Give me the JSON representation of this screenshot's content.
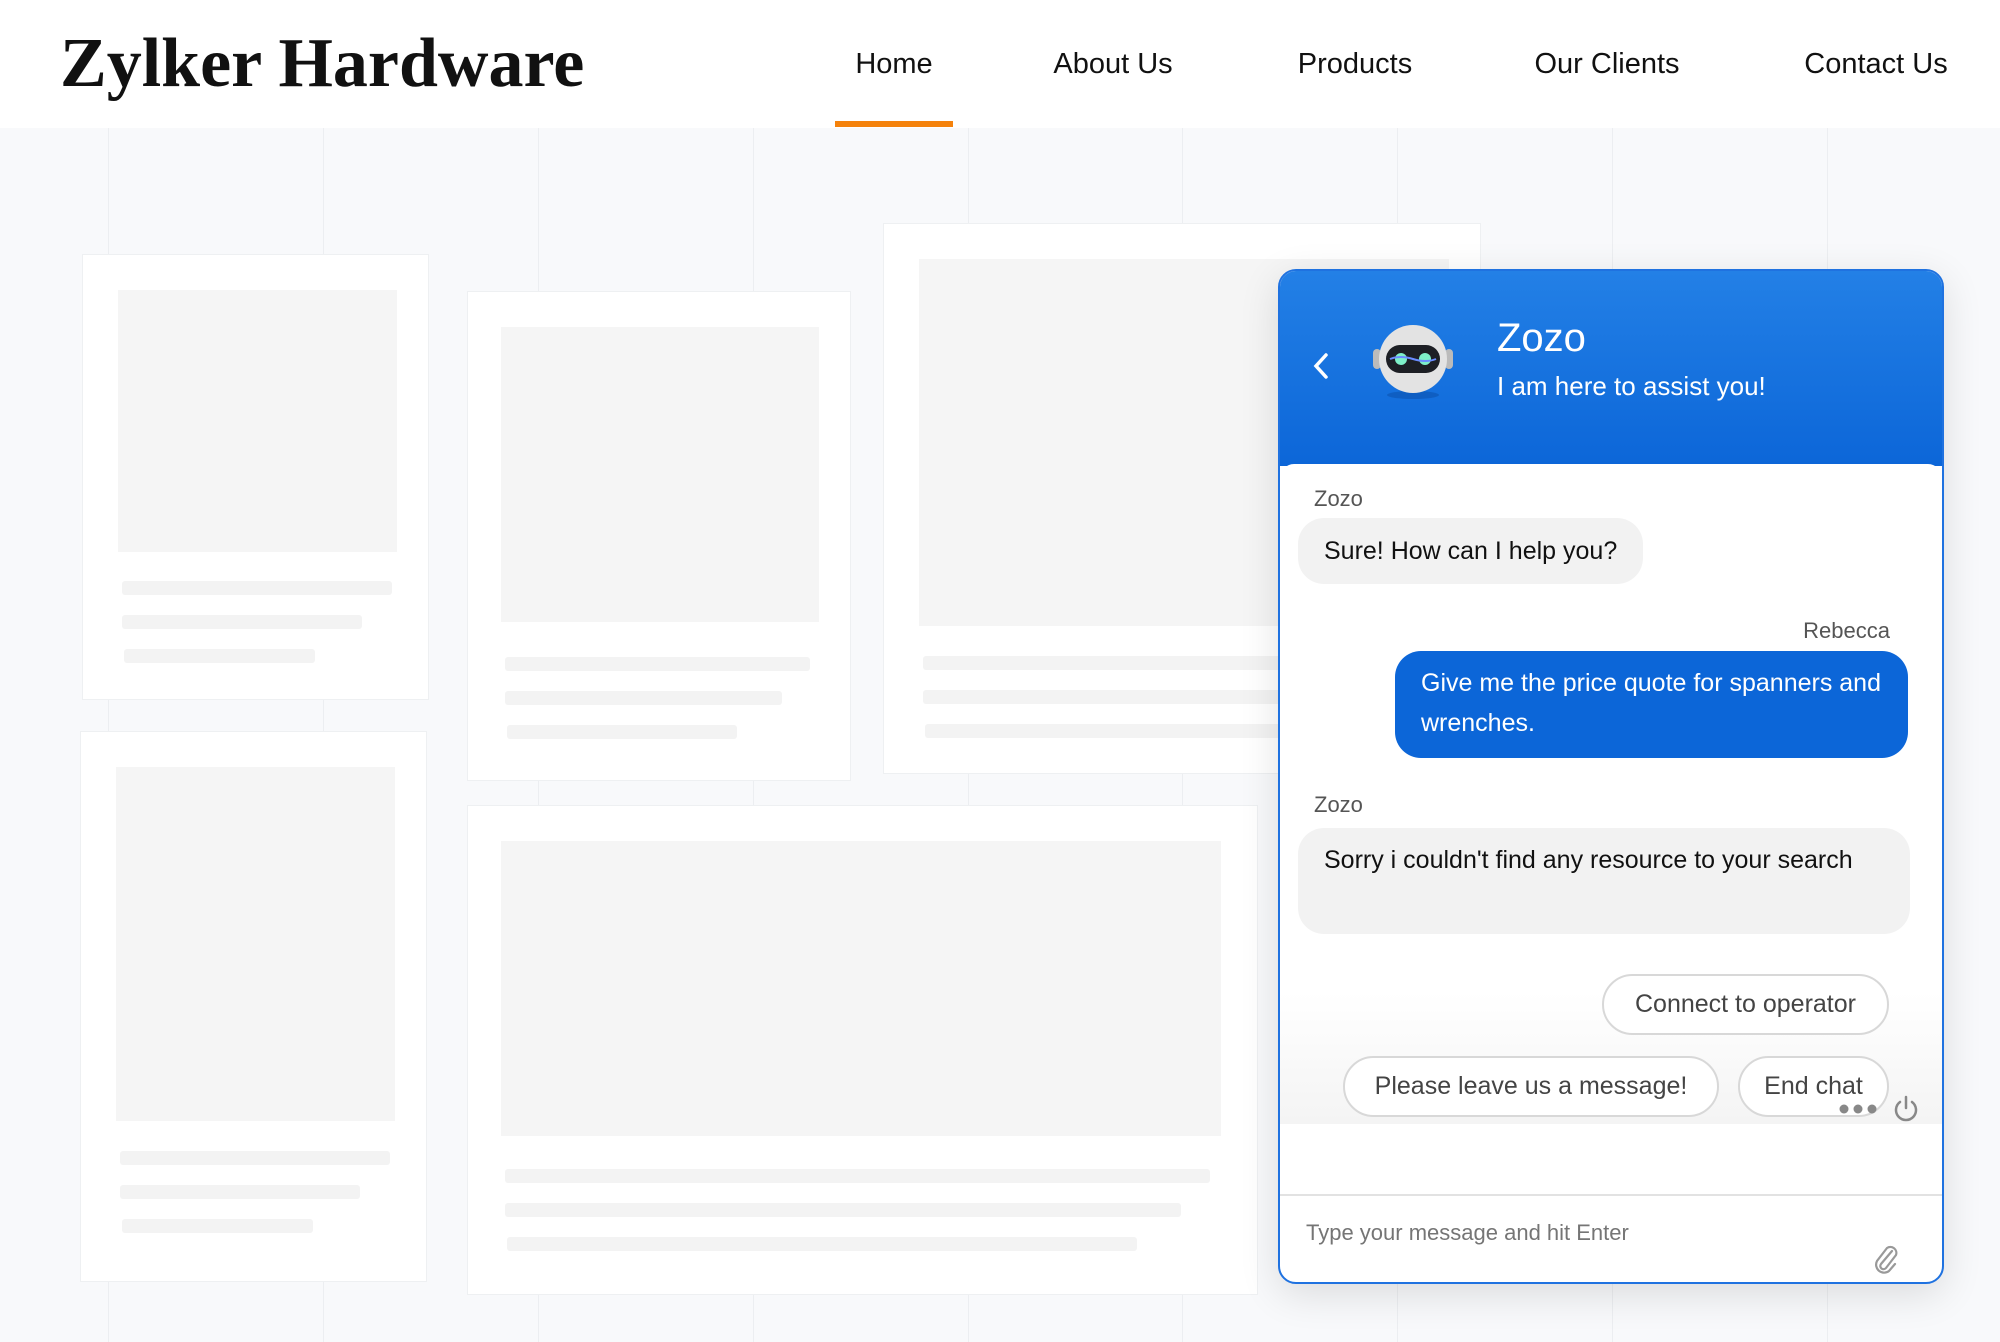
{
  "site": {
    "logo": "Zylker Hardware",
    "nav": [
      "Home",
      "About Us",
      "Products",
      "Our Clients",
      "Contact Us"
    ],
    "active_nav": "Home",
    "accent": "#f5820b"
  },
  "chat": {
    "bot_name": "Zozo",
    "bot_tagline": "I am here to assist you!",
    "brand_color": "#0c66d8",
    "messages": [
      {
        "sender": "Zozo",
        "text": "Sure! How can I help you?"
      },
      {
        "sender": "Rebecca",
        "text": "Give me the price quote for spanners and wrenches."
      },
      {
        "sender": "Zozo",
        "text": "Sorry i couldn't find any resource to your search"
      }
    ],
    "options": [
      "Connect to operator",
      "Please leave us a message!",
      "End chat"
    ],
    "input_placeholder": "Type your message and hit Enter"
  }
}
